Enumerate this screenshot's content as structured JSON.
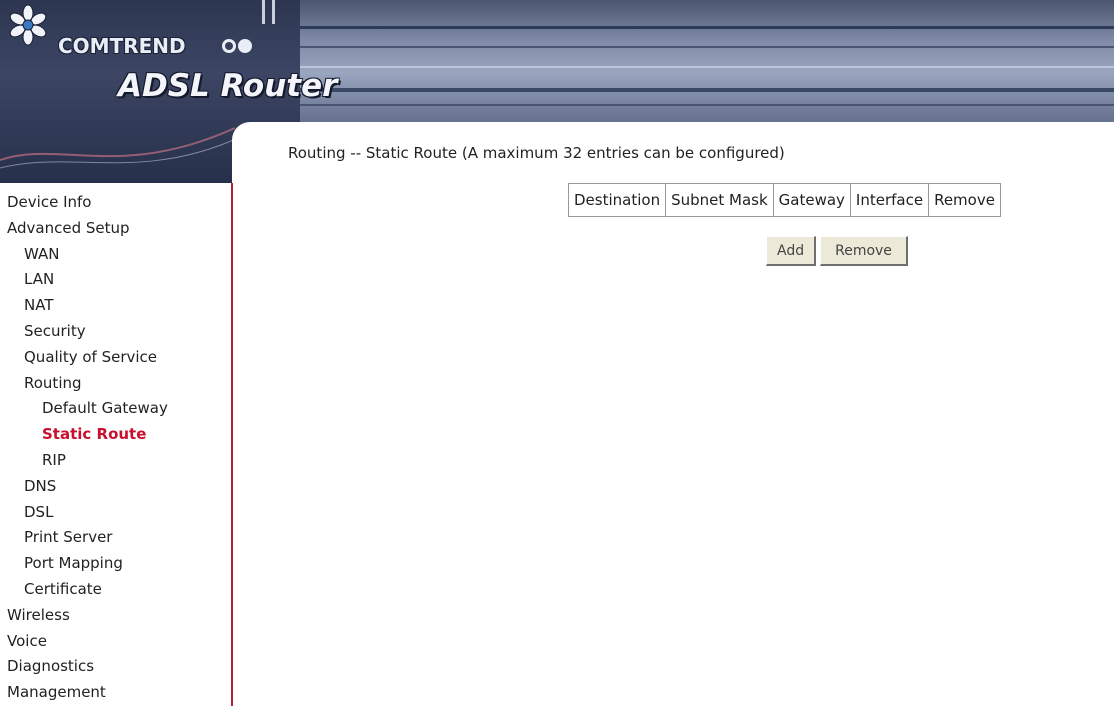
{
  "header": {
    "brand": "COMTREND",
    "product": "ADSL Router",
    "logo_icon": "flower-logo-icon"
  },
  "sidebar": {
    "items": [
      {
        "label": "Device Info",
        "level": 0,
        "active": false
      },
      {
        "label": "Advanced Setup",
        "level": 0,
        "active": false
      },
      {
        "label": "WAN",
        "level": 1,
        "active": false
      },
      {
        "label": "LAN",
        "level": 1,
        "active": false
      },
      {
        "label": "NAT",
        "level": 1,
        "active": false
      },
      {
        "label": "Security",
        "level": 1,
        "active": false
      },
      {
        "label": "Quality of Service",
        "level": 1,
        "active": false
      },
      {
        "label": "Routing",
        "level": 1,
        "active": false
      },
      {
        "label": "Default Gateway",
        "level": 2,
        "active": false
      },
      {
        "label": "Static Route",
        "level": 2,
        "active": true
      },
      {
        "label": "RIP",
        "level": 2,
        "active": false
      },
      {
        "label": "DNS",
        "level": 1,
        "active": false
      },
      {
        "label": "DSL",
        "level": 1,
        "active": false
      },
      {
        "label": "Print Server",
        "level": 1,
        "active": false
      },
      {
        "label": "Port Mapping",
        "level": 1,
        "active": false
      },
      {
        "label": "Certificate",
        "level": 1,
        "active": false
      },
      {
        "label": "Wireless",
        "level": 0,
        "active": false
      },
      {
        "label": "Voice",
        "level": 0,
        "active": false
      },
      {
        "label": "Diagnostics",
        "level": 0,
        "active": false
      },
      {
        "label": "Management",
        "level": 0,
        "active": false
      }
    ]
  },
  "main": {
    "title": "Routing -- Static Route (A maximum 32 entries can be configured)",
    "table": {
      "columns": [
        "Destination",
        "Subnet Mask",
        "Gateway",
        "Interface",
        "Remove"
      ],
      "rows": []
    },
    "buttons": {
      "add": "Add",
      "remove": "Remove"
    }
  },
  "colors": {
    "active_nav": "#c8102e",
    "sidebar_border": "#b02040",
    "banner": "#7f8aa6"
  }
}
